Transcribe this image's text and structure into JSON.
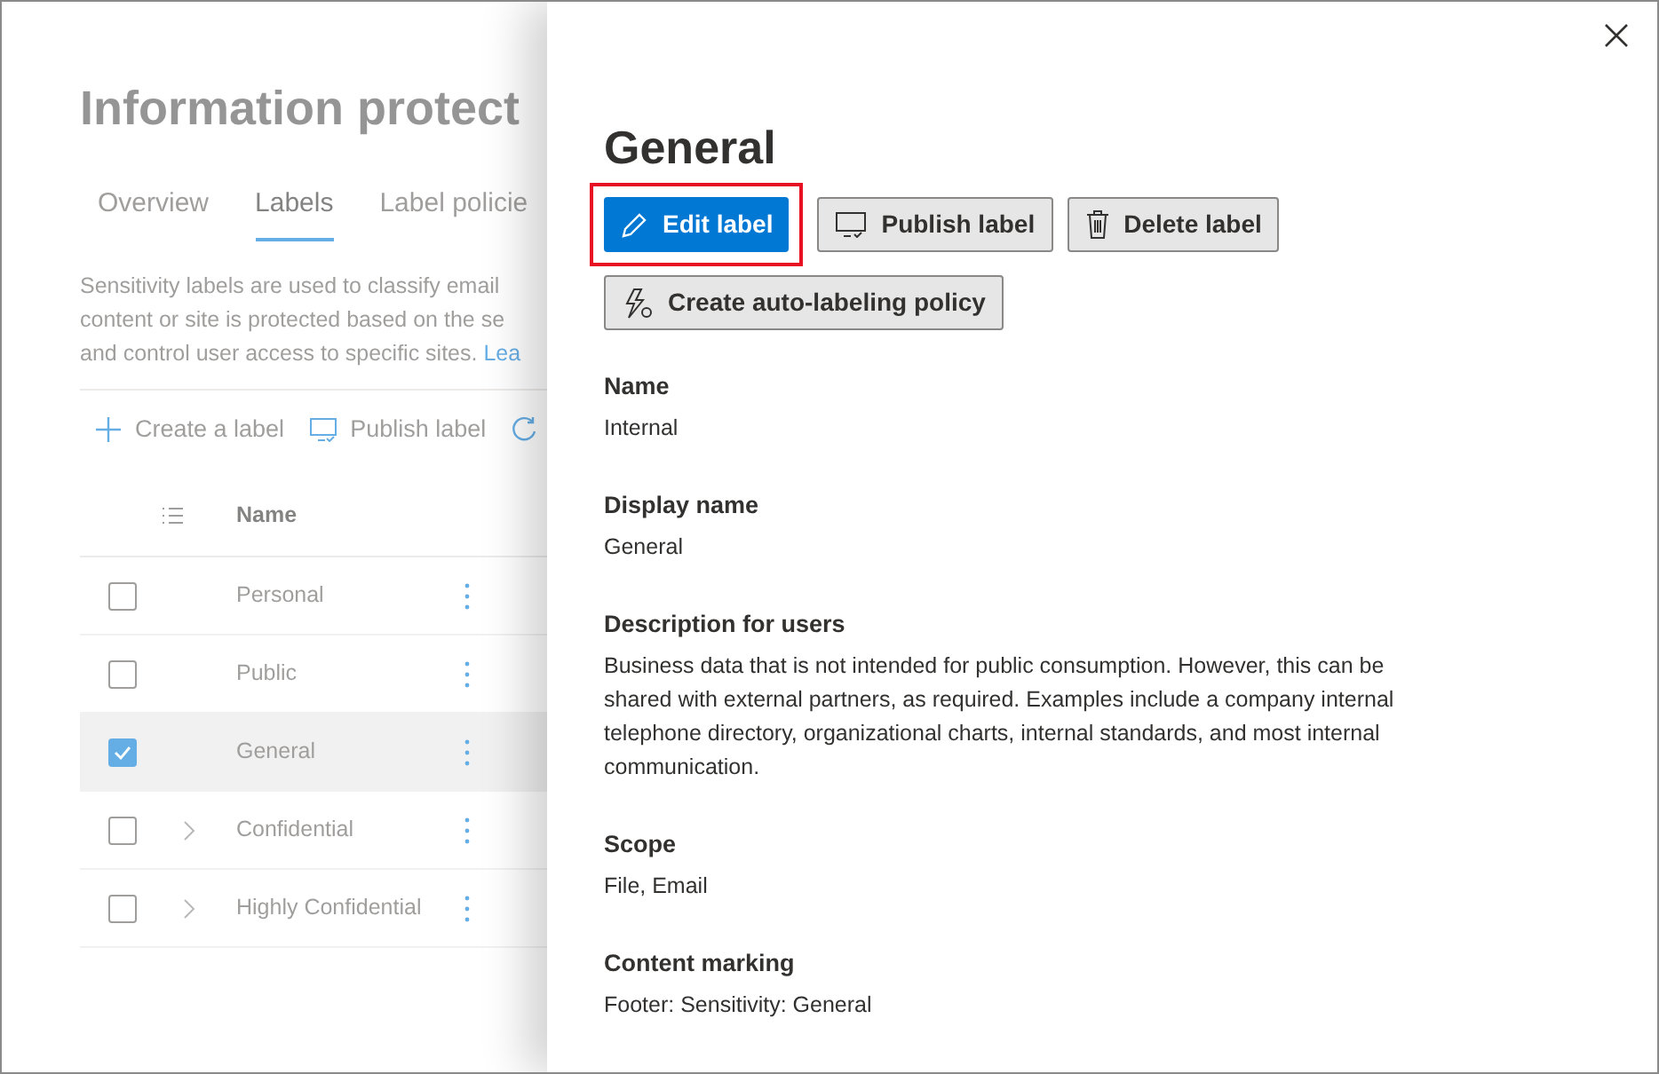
{
  "page": {
    "title": "Information protect",
    "tabs": [
      {
        "label": "Overview",
        "selected": false
      },
      {
        "label": "Labels",
        "selected": true
      },
      {
        "label": "Label policie",
        "selected": false
      }
    ],
    "description_lines": [
      "Sensitivity labels are used to classify email",
      "content or site is protected based on the se",
      "and control user access to specific sites."
    ],
    "description_link": "Lea",
    "toolbar": [
      "Create a label",
      "Publish label"
    ],
    "table": {
      "columns": [
        "Name"
      ],
      "rows": [
        {
          "name": "Personal",
          "checked": false,
          "selected": false,
          "expandable": false
        },
        {
          "name": "Public",
          "checked": false,
          "selected": false,
          "expandable": false
        },
        {
          "name": "General",
          "checked": true,
          "selected": true,
          "expandable": false
        },
        {
          "name": "Confidential",
          "checked": false,
          "selected": false,
          "expandable": true
        },
        {
          "name": "Highly Confidential",
          "checked": false,
          "selected": false,
          "expandable": true
        }
      ]
    }
  },
  "panel": {
    "title": "General",
    "buttons": [
      {
        "label": "Edit label",
        "kind": "edit",
        "primary": true,
        "highlighted": true
      },
      {
        "label": "Publish label",
        "kind": "publish",
        "primary": false,
        "highlighted": false
      },
      {
        "label": "Delete label",
        "kind": "delete",
        "primary": false,
        "highlighted": false
      },
      {
        "label": "Create auto-labeling policy",
        "kind": "auto",
        "primary": false,
        "highlighted": false
      }
    ],
    "fields": [
      {
        "label": "Name",
        "value": "Internal"
      },
      {
        "label": "Display name",
        "value": "General"
      },
      {
        "label": "Description for users",
        "value": "Business data that is not intended for public consumption. However, this can be shared with external partners, as required. Examples include a company internal telephone directory, organizational charts, internal standards, and most internal communication."
      },
      {
        "label": "Scope",
        "value": "File, Email"
      },
      {
        "label": "Content marking",
        "value": "Footer: Sensitivity: General"
      }
    ]
  }
}
